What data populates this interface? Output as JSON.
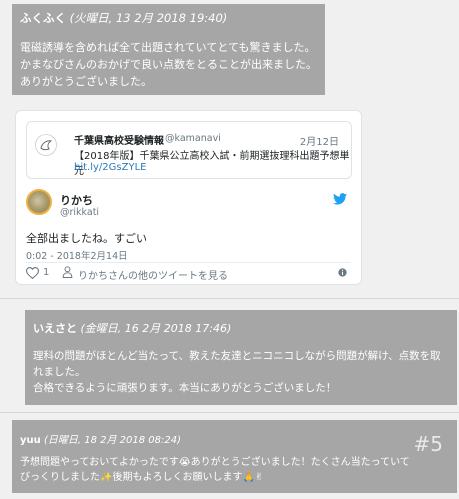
{
  "comments": [
    {
      "name": "ふくふく",
      "date": "(火曜日, 13 2月 2018 19:40)",
      "lines": [
        "電磁誘導を含めれば全て出題されていてとても驚きました。",
        "かまなびさんのおかげで良い点数をとることが出来ました。",
        "ありがとうございました。"
      ]
    },
    {
      "name": "いえさと",
      "date": "(金曜日, 16 2月 2018 17:46)",
      "lines": [
        "理科の問題がほとんど当たって、教えた友達とニコニコしながら問題が解け、点数を取",
        "れました。",
        "合格できるように頑張ります。本当にありがとうございました！"
      ]
    },
    {
      "name": "yuu",
      "date": "(日曜日, 18 2月 2018 08:24)",
      "number": "#5",
      "lines": [
        "予想問題やっておいてよかったです😭ありがとうございました！たくさん当たっていて",
        "びっくりしました✨後期もよろしくお願いします🙏✌"
      ]
    }
  ],
  "tweet": {
    "quoted": {
      "name": "千葉県高校受験情報",
      "handle": "@kamanavi",
      "date": "2月12日",
      "text": "【2018年版】千葉県公立高校入試・前期選抜理科出題予想単元",
      "link": "bit.ly/2GsZYLE"
    },
    "author_name": "りかち",
    "author_handle": "@rikkati",
    "text": "全部出ましたね。すごい",
    "timestamp": "0:02 - 2018年2月14日",
    "likes": "1",
    "more_tweets": "りかちさんの他のツイートを見る",
    "icons": [
      "avatar-icon",
      "twitter-bird-icon",
      "heart-icon",
      "person-icon",
      "info-icon"
    ],
    "colors": {
      "link": "#2b7bb9",
      "bird": "#1da1f2",
      "text": "#1c2022",
      "muted": "#697882"
    }
  },
  "colors": {
    "comment_bg": "#a6a6a6",
    "page_bg": "#f0f0f0"
  }
}
